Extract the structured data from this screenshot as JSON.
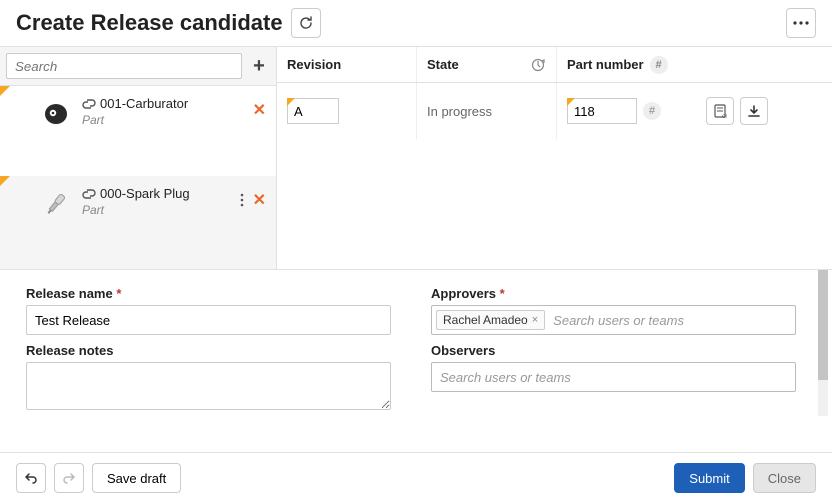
{
  "header": {
    "title": "Create Release candidate"
  },
  "search": {
    "placeholder": "Search"
  },
  "parts": [
    {
      "name": "001-Carburator",
      "type": "Part"
    },
    {
      "name": "000-Spark Plug",
      "type": "Part"
    }
  ],
  "table": {
    "head": {
      "revision": "Revision",
      "state": "State",
      "part_number": "Part number"
    },
    "row": {
      "revision": "A",
      "state": "In progress",
      "part_number": "118"
    }
  },
  "form": {
    "release_name_label": "Release name",
    "release_name_value": "Test Release",
    "release_notes_label": "Release notes",
    "approvers_label": "Approvers",
    "approver_chip": "Rachel Amadeo",
    "observers_label": "Observers",
    "search_users_ph": "Search users or teams",
    "required_mark": "*"
  },
  "footer": {
    "save_draft": "Save draft",
    "submit": "Submit",
    "close": "Close"
  }
}
